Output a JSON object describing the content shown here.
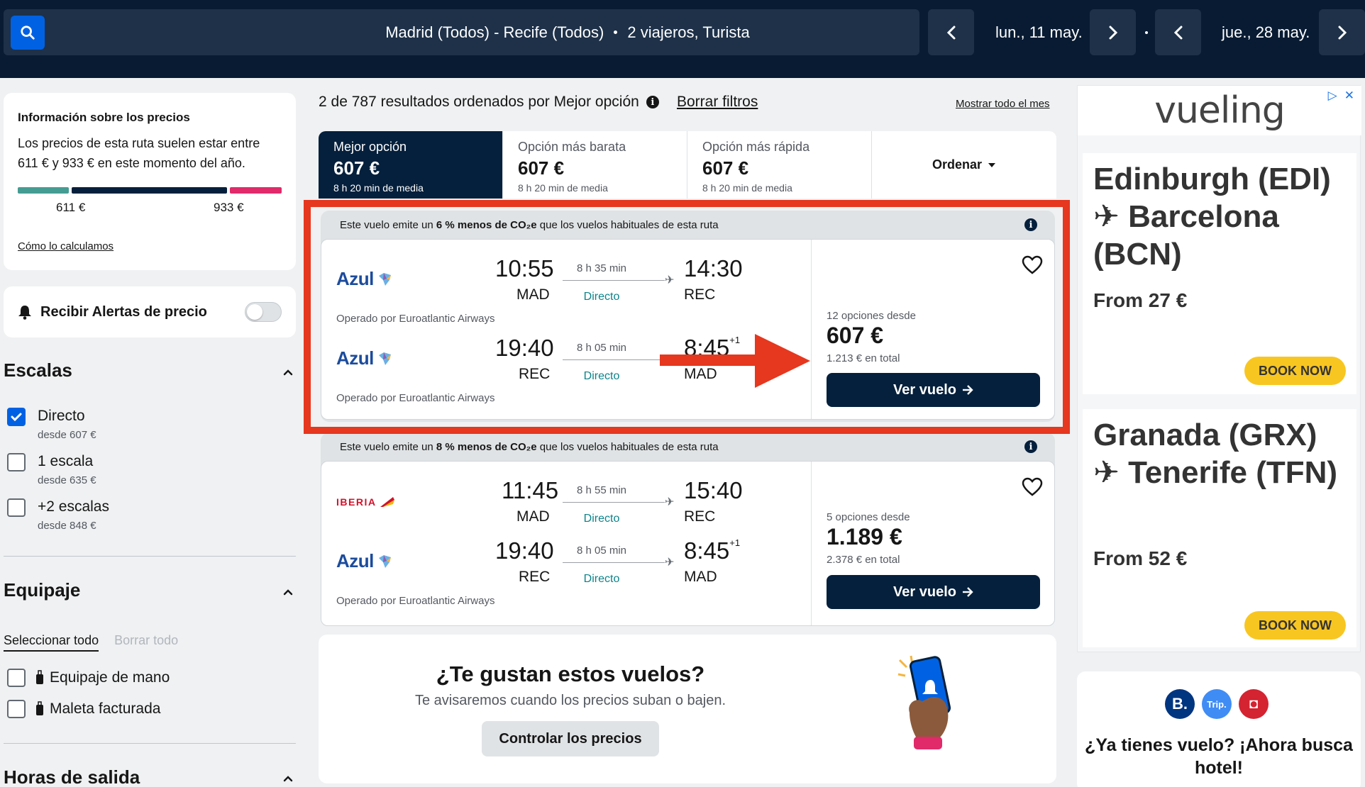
{
  "search": {
    "route": "Madrid (Todos) - Recife (Todos)",
    "travelers": "2 viajeros, Turista",
    "depart_date": "lun., 11 may.",
    "return_date": "jue., 28 may."
  },
  "price_info": {
    "title": "Información sobre los precios",
    "text": "Los precios de esta ruta suelen estar entre 611 € y 933 € en este momento del año.",
    "low": "611 €",
    "high": "933 €",
    "link": "Cómo lo calculamos",
    "colors": [
      "#459c93",
      "#05203c",
      "#e02a6a"
    ]
  },
  "alerts": {
    "label": "Recibir Alertas de precio",
    "enabled": false
  },
  "filters": {
    "stops_title": "Escalas",
    "stops": [
      {
        "label": "Directo",
        "sub": "desde 607 €",
        "checked": true
      },
      {
        "label": "1 escala",
        "sub": "desde 635 €",
        "checked": false
      },
      {
        "label": "+2 escalas",
        "sub": "desde 848 €",
        "checked": false
      }
    ],
    "baggage_title": "Equipaje",
    "select_all": "Seleccionar todo",
    "clear_all": "Borrar todo",
    "baggage": [
      {
        "label": "Equipaje de mano",
        "checked": false
      },
      {
        "label": "Maleta facturada",
        "checked": false
      }
    ],
    "departure_title": "Horas de salida"
  },
  "results": {
    "summary": "2 de 787 resultados ordenados por Mejor opción",
    "clear_filters": "Borrar filtros",
    "show_month": "Mostrar todo el mes"
  },
  "sort_tabs": [
    {
      "label": "Mejor opción",
      "price": "607 €",
      "sub": "8 h 20 min de media"
    },
    {
      "label": "Opción más barata",
      "price": "607 €",
      "sub": "8 h 20 min de media"
    },
    {
      "label": "Opción más rápida",
      "price": "607 €",
      "sub": "8 h 20 min de media"
    }
  ],
  "order_label": "Ordenar",
  "flights": [
    {
      "eco_pre": "Este vuelo emite un ",
      "eco_bold": "6 % menos de CO₂e",
      "eco_post": " que los vuelos habituales de esta ruta",
      "legs": [
        {
          "airline": "Azul",
          "dep_time": "10:55",
          "dep_code": "MAD",
          "duration": "8 h 35 min",
          "stops": "Directo",
          "arr_time": "14:30",
          "arr_plus": "",
          "arr_code": "REC",
          "operated": "Operado por Euroatlantic Airways"
        },
        {
          "airline": "Azul",
          "dep_time": "19:40",
          "dep_code": "REC",
          "duration": "8 h 05 min",
          "stops": "Directo",
          "arr_time": "8:45",
          "arr_plus": "+1",
          "arr_code": "MAD",
          "operated": "Operado por Euroatlantic Airways"
        }
      ],
      "options": "12 opciones desde",
      "price": "607 €",
      "total": "1.213 € en total",
      "cta": "Ver vuelo"
    },
    {
      "eco_pre": "Este vuelo emite un ",
      "eco_bold": "8 % menos de CO₂e",
      "eco_post": " que los vuelos habituales de esta ruta",
      "legs": [
        {
          "airline": "IBERIA",
          "dep_time": "11:45",
          "dep_code": "MAD",
          "duration": "8 h 55 min",
          "stops": "Directo",
          "arr_time": "15:40",
          "arr_plus": "",
          "arr_code": "REC",
          "operated": ""
        },
        {
          "airline": "Azul",
          "dep_time": "19:40",
          "dep_code": "REC",
          "duration": "8 h 05 min",
          "stops": "Directo",
          "arr_time": "8:45",
          "arr_plus": "+1",
          "arr_code": "MAD",
          "operated": "Operado por Euroatlantic Airways"
        }
      ],
      "options": "5 opciones desde",
      "price": "1.189 €",
      "total": "2.378 € en total",
      "cta": "Ver vuelo"
    }
  ],
  "promo": {
    "title": "¿Te gustan estos vuelos?",
    "text": "Te avisaremos cuando los precios suban o bajen.",
    "button": "Controlar los precios"
  },
  "ad": {
    "brand": "vueling",
    "cards": [
      {
        "route": "Edinburgh (EDI) ✈ Barcelona (BCN)",
        "from": "From 27 €",
        "cta": "BOOK NOW"
      },
      {
        "route": "Granada (GRX) ✈ Tenerife (TFN)",
        "from": "From 52 €",
        "cta": "BOOK NOW"
      }
    ]
  },
  "hotel_ad": {
    "icons": [
      "B.",
      "Trip.",
      "◘"
    ],
    "title": "¿Ya tienes vuelo? ¡Ahora busca hotel!"
  },
  "colors": {
    "navy": "#05203c",
    "blue": "#0062e3",
    "teal": "#0c838a",
    "red": "#e6371f",
    "yellow": "#f8c620"
  }
}
